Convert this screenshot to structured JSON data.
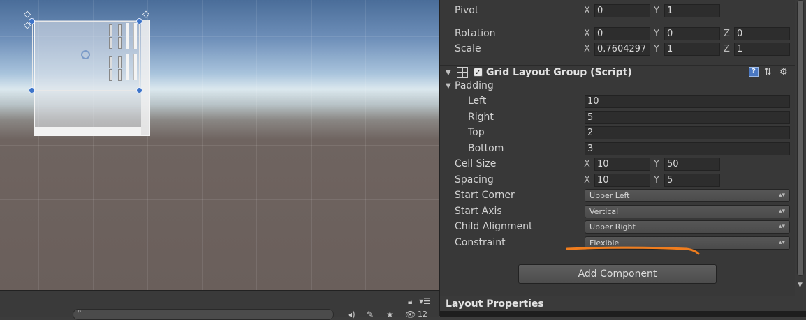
{
  "inspector": {
    "pivot": {
      "label": "Pivot",
      "x_axis": "X",
      "x": "0",
      "y_axis": "Y",
      "y": "1"
    },
    "rotation": {
      "label": "Rotation",
      "x_axis": "X",
      "x": "0",
      "y_axis": "Y",
      "y": "0",
      "z_axis": "Z",
      "z": "0"
    },
    "scale": {
      "label": "Scale",
      "x_axis": "X",
      "x": "0.7604297",
      "y_axis": "Y",
      "y": "1",
      "z_axis": "Z",
      "z": "1"
    },
    "component": {
      "title": "Grid Layout Group (Script)",
      "enabled_mark": "✓",
      "help_glyph": "?",
      "icons": [
        "grid-layout-icon",
        "help-icon",
        "preset-icon",
        "gear-icon"
      ]
    },
    "padding": {
      "label": "Padding",
      "left": {
        "label": "Left",
        "value": "10"
      },
      "right": {
        "label": "Right",
        "value": "5"
      },
      "top": {
        "label": "Top",
        "value": "2"
      },
      "bottom": {
        "label": "Bottom",
        "value": "3"
      }
    },
    "cell_size": {
      "label": "Cell Size",
      "x_axis": "X",
      "x": "10",
      "y_axis": "Y",
      "y": "50"
    },
    "spacing": {
      "label": "Spacing",
      "x_axis": "X",
      "x": "10",
      "y_axis": "Y",
      "y": "5"
    },
    "start_corner": {
      "label": "Start Corner",
      "value": "Upper Left"
    },
    "start_axis": {
      "label": "Start Axis",
      "value": "Vertical"
    },
    "child_alignment": {
      "label": "Child Alignment",
      "value": "Upper Right"
    },
    "constraint": {
      "label": "Constraint",
      "value": "Flexible"
    },
    "add_component": "Add Component",
    "layout_properties": "Layout Properties"
  },
  "scene_toolbar": {
    "visible_count": "12"
  },
  "colors": {
    "annotation_stroke": "#f07d1e",
    "handle_blue": "#3d74c9",
    "inspector_bg": "#383838"
  }
}
